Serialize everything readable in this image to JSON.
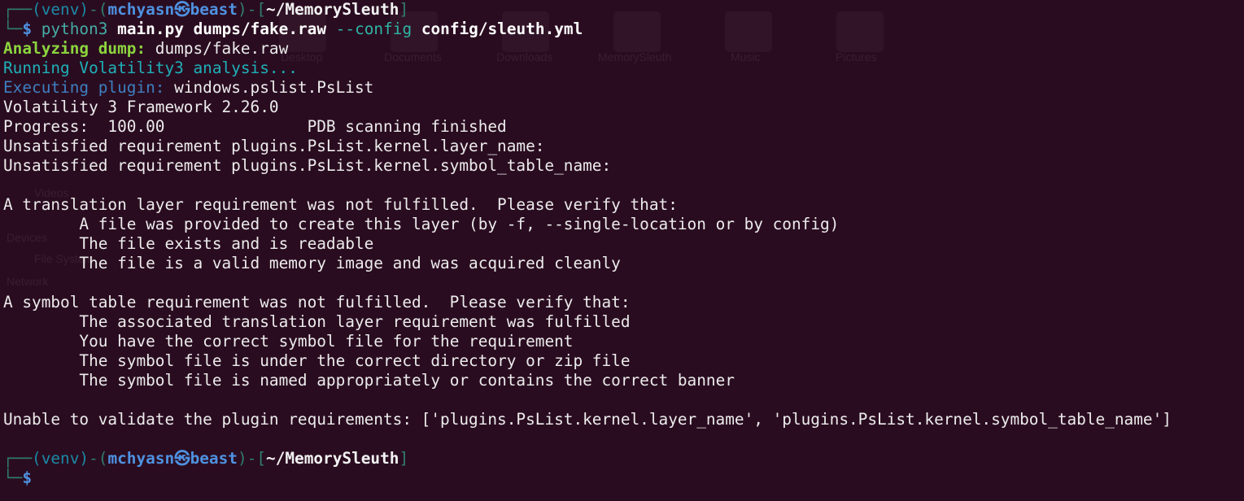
{
  "background_ghost": {
    "folders": [
      "Desktop",
      "Documents",
      "Downloads",
      "MemorySleuth",
      "Music",
      "Pictures"
    ],
    "sidebar": [
      "Videos",
      "Devices",
      "File System",
      "Network"
    ]
  },
  "prompt1": {
    "corner": "┌──",
    "venv": "(venv)",
    "dash": "-",
    "open": "(",
    "user": "mchyasn",
    "at": "㉿",
    "host": "beast",
    "close": ")",
    "cwd_open": "[",
    "cwd": "~/MemorySleuth",
    "cwd_close": "]",
    "corner2": "└─",
    "dollar": "$",
    "cmd": "python3",
    "arg1": "main.py",
    "arg2": "dumps/fake.raw",
    "flag": "--config",
    "arg3": "config/sleuth.yml"
  },
  "output": {
    "analyzing_label": "Analyzing dump:",
    "analyzing_value": " dumps/fake.raw",
    "running": "Running Volatility3 analysis...",
    "executing_label": "Executing plugin:",
    "executing_value": " windows.pslist.PsList",
    "lines": [
      "Volatility 3 Framework 2.26.0",
      "Progress:  100.00\t\tPDB scanning finished",
      "Unsatisfied requirement plugins.PsList.kernel.layer_name:",
      "Unsatisfied requirement plugins.PsList.kernel.symbol_table_name:",
      "",
      "A translation layer requirement was not fulfilled.  Please verify that:",
      "\tA file was provided to create this layer (by -f, --single-location or by config)",
      "\tThe file exists and is readable",
      "\tThe file is a valid memory image and was acquired cleanly",
      "",
      "A symbol table requirement was not fulfilled.  Please verify that:",
      "\tThe associated translation layer requirement was fulfilled",
      "\tYou have the correct symbol file for the requirement",
      "\tThe symbol file is under the correct directory or zip file",
      "\tThe symbol file is named appropriately or contains the correct banner",
      "",
      "Unable to validate the plugin requirements: ['plugins.PsList.kernel.layer_name', 'plugins.PsList.kernel.symbol_table_name']",
      ""
    ]
  },
  "prompt2": {
    "corner": "┌──",
    "venv": "(venv)",
    "dash": "-",
    "open": "(",
    "user": "mchyasn",
    "at": "㉿",
    "host": "beast",
    "close": ")",
    "cwd_open": "[",
    "cwd": "~/MemorySleuth",
    "cwd_close": "]",
    "corner2": "└─",
    "dollar": "$"
  },
  "colors": {
    "background": "#2a0c20",
    "text": "#ececec",
    "prompt_frame": "#2f7e6e",
    "user_host": "#4e91e0",
    "analyzing": "#8bd43e",
    "running": "#1fb0b8",
    "executing": "#3e7fc0"
  }
}
